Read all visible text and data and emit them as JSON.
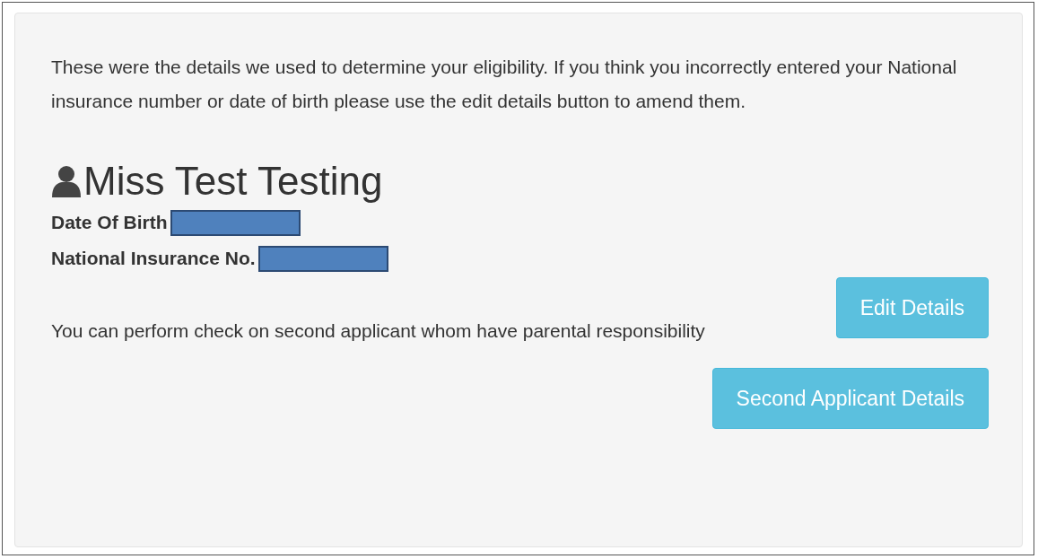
{
  "intro": "These were the details we used to determine your eligibility. If you think you incorrectly entered your National insurance number or date of birth please use the edit details button to amend them.",
  "applicant": {
    "name": "Miss Test Testing"
  },
  "details": [
    {
      "label": "Date Of Birth",
      "redacted": true
    },
    {
      "label": "National Insurance No.",
      "redacted": true
    }
  ],
  "note": "You can perform check on second applicant whom have parental responsibility",
  "buttons": [
    {
      "label": "Edit Details"
    },
    {
      "label": "Second Applicant Details"
    }
  ]
}
